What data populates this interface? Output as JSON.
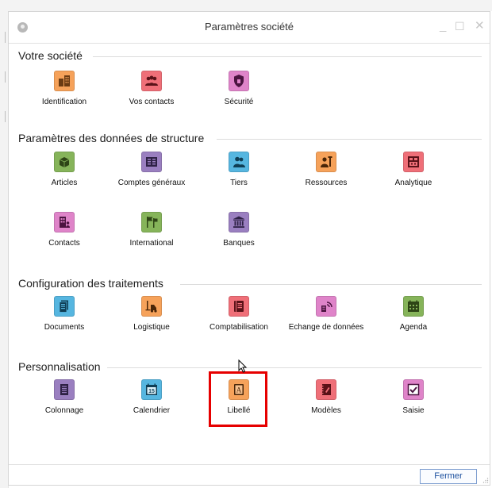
{
  "window": {
    "title": "Paramètres société",
    "minimize_glyph": "_",
    "maximize_glyph": "☐",
    "close_glyph": "✕"
  },
  "sections": [
    {
      "title": "Votre société",
      "items": [
        {
          "label": "Identification",
          "icon": "building-icon",
          "color": "#f6a25a"
        },
        {
          "label": "Vos contacts",
          "icon": "contacts-group-icon",
          "color": "#ef6f78"
        },
        {
          "label": "Sécurité",
          "icon": "shield-icon",
          "color": "#df84c9"
        }
      ]
    },
    {
      "title": "Paramètres des données de structure",
      "items": [
        {
          "label": "Articles",
          "icon": "cube-icon",
          "color": "#86b45a"
        },
        {
          "label": "Comptes généraux",
          "icon": "ledger-icon",
          "color": "#9a7fc0"
        },
        {
          "label": "Tiers",
          "icon": "people-icon",
          "color": "#56b6e0"
        },
        {
          "label": "Ressources",
          "icon": "worker-icon",
          "color": "#f6a25a"
        },
        {
          "label": "Analytique",
          "icon": "org-chart-icon",
          "color": "#ef6f78"
        },
        {
          "label": "Contacts",
          "icon": "contact-card-icon",
          "color": "#df84c9"
        },
        {
          "label": "International",
          "icon": "flags-icon",
          "color": "#86b45a"
        },
        {
          "label": "Banques",
          "icon": "bank-icon",
          "color": "#9a7fc0"
        }
      ]
    },
    {
      "title": "Configuration des traitements",
      "items": [
        {
          "label": "Documents",
          "icon": "document-icon",
          "color": "#56b6e0"
        },
        {
          "label": "Logistique",
          "icon": "forklift-icon",
          "color": "#f6a25a"
        },
        {
          "label": "Comptabilisation",
          "icon": "book-icon",
          "color": "#ef6f78"
        },
        {
          "label": "Echange de données",
          "icon": "data-exchange-icon",
          "color": "#df84c9"
        },
        {
          "label": "Agenda",
          "icon": "calendar-grid-icon",
          "color": "#86b45a"
        }
      ]
    },
    {
      "title": "Personnalisation",
      "items": [
        {
          "label": "Colonnage",
          "icon": "columns-icon",
          "color": "#9a7fc0"
        },
        {
          "label": "Calendrier",
          "icon": "calendar-icon",
          "color": "#56b6e0",
          "badge": "15"
        },
        {
          "label": "Libellé",
          "icon": "label-book-icon",
          "color": "#f6a25a",
          "glyph": "A"
        },
        {
          "label": "Modèles",
          "icon": "notebook-icon",
          "color": "#ef6f78"
        },
        {
          "label": "Saisie",
          "icon": "checkbox-icon",
          "color": "#df84c9"
        }
      ]
    }
  ],
  "footer": {
    "close_label": "Fermer"
  }
}
